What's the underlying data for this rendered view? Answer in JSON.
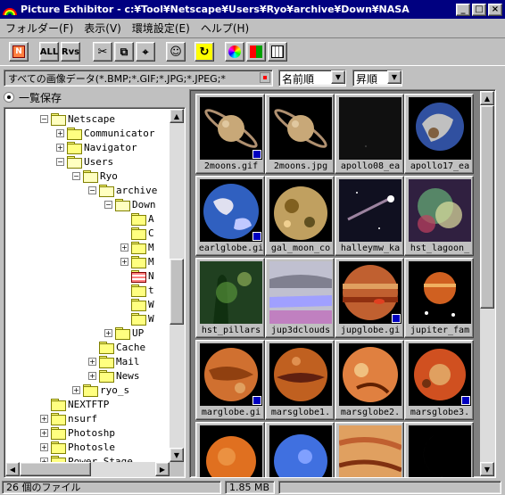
{
  "window": {
    "title": "Picture Exhibitor - c:¥Tool¥Netscape¥Users¥Ryo¥archive¥Down¥NASA",
    "minimize": "_",
    "maximize": "□",
    "close": "×"
  },
  "menu": [
    "フォルダー(F)",
    "表示(V)",
    "環境設定(E)",
    "ヘルプ(H)"
  ],
  "toolbar": {
    "all_label": "ALL",
    "rvs_label": "Rvs",
    "cut_icon": "scissors-icon",
    "copy_icon": "copy-icon",
    "paste_icon": "paste-icon",
    "view_icon": "face-icon",
    "refresh_icon": "refresh-icon",
    "color_icon": "color-wheel-icon",
    "tiles_icon": "tiles-icon",
    "grid_icon": "grid-icon"
  },
  "filter": {
    "value": "すべての画像データ(*.BMP;*.GIF;*.JPG;*.JPEG;*",
    "sort_field": "名前順",
    "sort_order": "昇順"
  },
  "left": {
    "list_save_label": "一覧保存",
    "tree": [
      {
        "label": "Netscape",
        "level": 2,
        "expander": "-",
        "open": true
      },
      {
        "label": "Communicator",
        "level": 3,
        "expander": "+"
      },
      {
        "label": "Navigator",
        "level": 3,
        "expander": "+"
      },
      {
        "label": "Users",
        "level": 3,
        "expander": "-",
        "open": true
      },
      {
        "label": "Ryo",
        "level": 4,
        "expander": "-",
        "open": true
      },
      {
        "label": "archive",
        "level": 5,
        "expander": "-",
        "open": true
      },
      {
        "label": "Down",
        "level": 6,
        "expander": "-",
        "open": true
      },
      {
        "label": "A",
        "level": 7
      },
      {
        "label": "C",
        "level": 7
      },
      {
        "label": "M",
        "level": 7,
        "expander": "+"
      },
      {
        "label": "M",
        "level": 7,
        "expander": "+"
      },
      {
        "label": "N",
        "level": 7,
        "special": true
      },
      {
        "label": "t",
        "level": 7
      },
      {
        "label": "W",
        "level": 7
      },
      {
        "label": "W",
        "level": 7
      },
      {
        "label": "UP",
        "level": 6,
        "expander": "+"
      },
      {
        "label": "Cache",
        "level": 5
      },
      {
        "label": "Mail",
        "level": 5,
        "expander": "+"
      },
      {
        "label": "News",
        "level": 5,
        "expander": "+"
      },
      {
        "label": "ryo_s",
        "level": 4,
        "expander": "+"
      },
      {
        "label": "NEXTFTP",
        "level": 2
      },
      {
        "label": "nsurf",
        "level": 2,
        "expander": "+"
      },
      {
        "label": "Photoshp",
        "level": 2,
        "expander": "+"
      },
      {
        "label": "Photosle",
        "level": 2,
        "expander": "+"
      },
      {
        "label": "Power Stage",
        "level": 2,
        "expander": "+"
      }
    ]
  },
  "grid": {
    "files": [
      {
        "name": "2moons.gif",
        "kind": "saturn",
        "badge": true
      },
      {
        "name": "2moons.jpg",
        "kind": "saturn",
        "badge": false
      },
      {
        "name": "apollo08_ea",
        "kind": "dark",
        "badge": false
      },
      {
        "name": "apollo17_ea",
        "kind": "earthsmall",
        "badge": false
      },
      {
        "name": "earlglobe.gi",
        "kind": "earth",
        "badge": true
      },
      {
        "name": "gal_moon_co",
        "kind": "moon",
        "badge": false
      },
      {
        "name": "halleymw_ka",
        "kind": "comet",
        "badge": false
      },
      {
        "name": "hst_lagoon_",
        "kind": "nebula",
        "badge": false
      },
      {
        "name": "hst_pillars",
        "kind": "pillars",
        "badge": false
      },
      {
        "name": "jup3dclouds",
        "kind": "clouds",
        "badge": false
      },
      {
        "name": "jupglobe.gi",
        "kind": "jupiter",
        "badge": true
      },
      {
        "name": "jupiter_fam",
        "kind": "jupfam",
        "badge": false
      },
      {
        "name": "marglobe.gi",
        "kind": "mars",
        "badge": true
      },
      {
        "name": "marsglobe1.",
        "kind": "mars2",
        "badge": false
      },
      {
        "name": "marsglobe2.",
        "kind": "mars3",
        "badge": false
      },
      {
        "name": "marsglobe3.",
        "kind": "mars4",
        "badge": true
      },
      {
        "name": "",
        "kind": "venus",
        "badge": false
      },
      {
        "name": "",
        "kind": "neptune",
        "badge": false
      },
      {
        "name": "",
        "kind": "jupclose",
        "badge": false
      },
      {
        "name": "",
        "kind": "crescent",
        "badge": false
      }
    ]
  },
  "status": {
    "count": "26 個のファイル",
    "size": "1.85 MB"
  }
}
